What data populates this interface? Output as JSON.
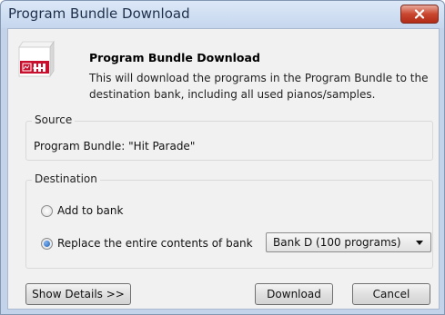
{
  "window": {
    "title": "Program Bundle Download"
  },
  "header": {
    "title": "Program Bundle Download",
    "description": "This will download the programs in the Program Bundle to the destination bank, including all used pianos/samples."
  },
  "source": {
    "legend": "Source",
    "text": "Program Bundle: \"Hit Parade\""
  },
  "destination": {
    "legend": "Destination",
    "option_add": "Add to bank",
    "option_replace": "Replace the entire contents of bank",
    "selected_option": "replace",
    "bank_select_value": "Bank D (100 programs)"
  },
  "buttons": {
    "show_details": "Show Details >>",
    "download": "Download",
    "cancel": "Cancel"
  },
  "colors": {
    "close_button": "#c9462f",
    "app_icon_red": "#c8102e"
  },
  "icons": {
    "close": "close-x-icon",
    "app": "program-bundle-app-icon"
  }
}
